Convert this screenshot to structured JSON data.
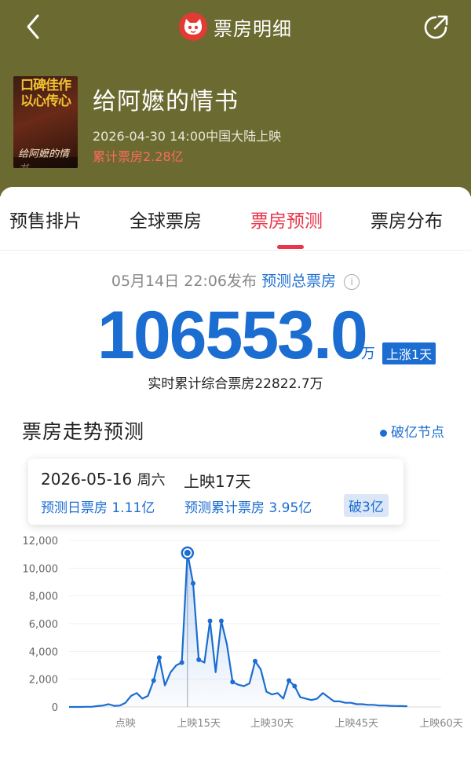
{
  "nav": {
    "title": "票房明细"
  },
  "movie": {
    "poster_slogan": "口碑佳作以心传心",
    "poster_title": "给阿嬷的情书",
    "title": "给阿嬷的情书",
    "release": "2026-04-30 14:00中国大陆上映",
    "total_box_office": "累计票房2.28亿"
  },
  "tabs": [
    "预售排片",
    "全球票房",
    "票房预测",
    "票房分布"
  ],
  "active_tab": "票房预测",
  "forecast": {
    "publish_time": "05月14日 22:06发布",
    "label": "预测总票房",
    "value": "106553.0",
    "unit": "万",
    "badge": "上涨1天",
    "realtime": "实时累计综合票房22822.7万"
  },
  "section": {
    "title": "票房走势预测",
    "legend": "破亿节点"
  },
  "tooltip": {
    "date": "2026-05-16",
    "weekday": "周六",
    "days": "上映17天",
    "daily": "预测日票房 1.11亿",
    "cumulative": "预测累计票房 3.95亿",
    "badge": "破3亿"
  },
  "colors": {
    "header": "#6b6a31",
    "accent": "#e8364a",
    "blue": "#1b6dd1"
  },
  "chart_data": {
    "type": "area",
    "ylim": [
      0,
      12000
    ],
    "yticks": [
      0,
      2000,
      4000,
      6000,
      8000,
      10000,
      12000
    ],
    "ytick_labels": [
      "0",
      "2,000",
      "4,000",
      "6,000",
      "8,000",
      "10,000",
      "12,000"
    ],
    "xtick_labels": [
      {
        "x": 4,
        "label": "点映"
      },
      {
        "x": 17,
        "label": "上映15天"
      },
      {
        "x": 30,
        "label": "上映30天"
      },
      {
        "x": 45,
        "label": "上映45天"
      },
      {
        "x": 60,
        "label": "上映60天"
      }
    ],
    "x": [
      -6,
      -5,
      -4,
      -3,
      -2,
      -1,
      0,
      1,
      2,
      3,
      4,
      5,
      6,
      7,
      8,
      9,
      10,
      11,
      12,
      13,
      14,
      15,
      16,
      17,
      18,
      19,
      20,
      21,
      22,
      23,
      24,
      25,
      26,
      27,
      28,
      29,
      30,
      31,
      32,
      33,
      34,
      35,
      36,
      37,
      38,
      39,
      40,
      41,
      42,
      43,
      44,
      45,
      46,
      47,
      48,
      49,
      50,
      51,
      52,
      53,
      54,
      55,
      56,
      57,
      58,
      59,
      60
    ],
    "values": [
      0,
      0,
      0,
      10,
      10,
      60,
      100,
      200,
      80,
      100,
      300,
      800,
      1000,
      600,
      800,
      1900,
      3550,
      1550,
      2500,
      3000,
      3200,
      11100,
      8900,
      3400,
      3200,
      6200,
      2500,
      6200,
      4500,
      1800,
      1600,
      1500,
      1700,
      3300,
      2700,
      1100,
      900,
      1000,
      600,
      1900,
      1500,
      700,
      600,
      500,
      600,
      1000,
      700,
      400,
      400,
      300,
      300,
      200,
      200,
      150,
      150,
      100,
      100,
      80,
      70,
      60,
      50
    ],
    "highlight_x": 15,
    "highlight_value": 11100,
    "marker_x": [
      9,
      10,
      14,
      15,
      16,
      17,
      19,
      21,
      23,
      27,
      33,
      34
    ]
  }
}
